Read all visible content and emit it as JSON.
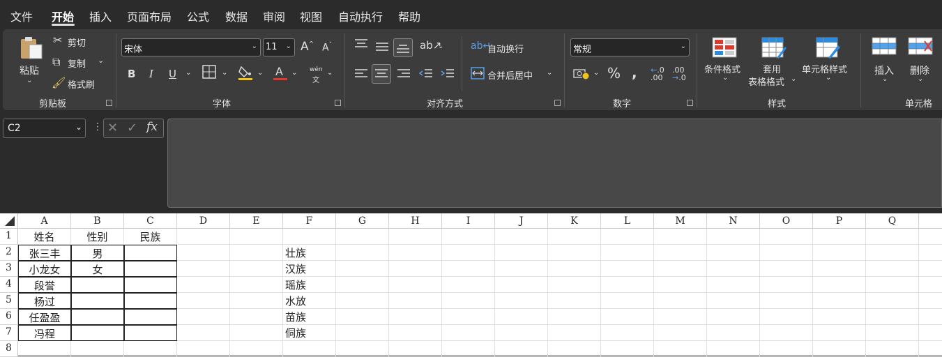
{
  "menu": {
    "items": [
      "文件",
      "开始",
      "插入",
      "页面布局",
      "公式",
      "数据",
      "审阅",
      "视图",
      "自动执行",
      "帮助"
    ],
    "active_index": 1
  },
  "ribbon": {
    "clipboard": {
      "paste": "粘贴",
      "cut": "剪切",
      "copy": "复制",
      "format_painter": "格式刷",
      "title": "剪贴板"
    },
    "font": {
      "font_name": "宋体",
      "font_size": "11",
      "title": "字体",
      "phonetic_top": "wén",
      "phonetic_bottom": "文"
    },
    "alignment": {
      "wrap_text": "自动换行",
      "merge_center": "合并后居中",
      "title": "对齐方式"
    },
    "number": {
      "format": "常规",
      "title": "数字"
    },
    "styles": {
      "conditional": "条件格式",
      "table_format_1": "套用",
      "table_format_2": "表格格式",
      "cell_styles": "单元格样式",
      "title": "样式"
    },
    "cells": {
      "insert": "插入",
      "delete": "删除",
      "title": "单元格"
    }
  },
  "formula_bar": {
    "name_box": "C2",
    "fx": "fx",
    "formula": ""
  },
  "sheet": {
    "columns": [
      "A",
      "B",
      "C",
      "D",
      "E",
      "F",
      "G",
      "H",
      "I",
      "J",
      "K",
      "L",
      "M",
      "N",
      "O",
      "P",
      "Q"
    ],
    "rows": [
      "1",
      "2",
      "3",
      "4",
      "5",
      "6",
      "7",
      "8"
    ],
    "table_header": [
      "姓名",
      "性别",
      "民族"
    ],
    "table_rows": [
      [
        "张三丰",
        "男",
        ""
      ],
      [
        "小龙女",
        "女",
        ""
      ],
      [
        "段誉",
        "",
        ""
      ],
      [
        "杨过",
        "",
        ""
      ],
      [
        "任盈盈",
        "",
        ""
      ],
      [
        "冯程",
        "",
        ""
      ]
    ],
    "column_f": [
      "壮族",
      "汉族",
      "瑶族",
      "水放",
      "苗族",
      "侗族"
    ]
  },
  "colors": {
    "ribbon_bg": "#3c3c3c",
    "app_bg": "#2b2b2b",
    "red": "#e03a2f",
    "blue": "#2a8be0",
    "yellow": "#f0c419"
  }
}
